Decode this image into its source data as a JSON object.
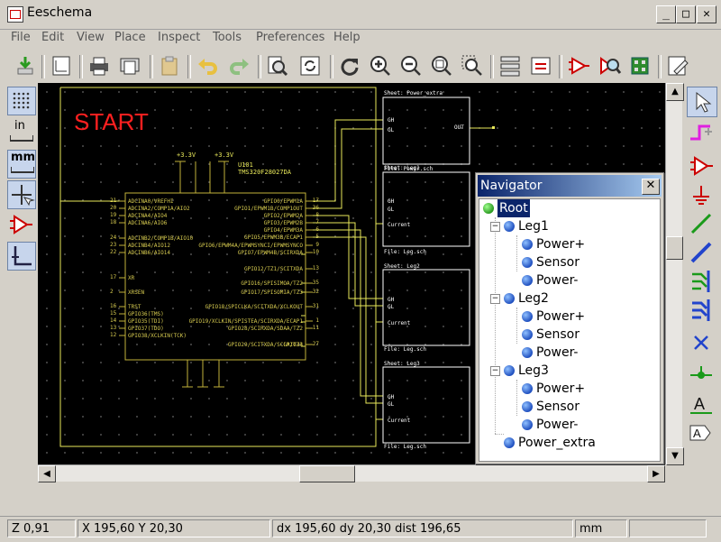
{
  "window": {
    "title": "Eeschema",
    "min": "_",
    "max": "□",
    "close": "✕"
  },
  "menu": [
    "File",
    "Edit",
    "View",
    "Place",
    "Inspect",
    "Tools",
    "Preferences",
    "Help"
  ],
  "left_toolbar": {
    "grid_icon": "grid-icon",
    "inches_label": "in",
    "mm_label": "mm",
    "cursor_icon": "crosshair-cursor-icon",
    "hidden_pins_icon": "hidden-pins-icon",
    "wire_mode_icon": "wire-angle-icon"
  },
  "schematic": {
    "start_label": "START",
    "sheets": [
      {
        "title": "Sheet: Power_extra",
        "file": "File: Power.sch",
        "pins": [
          "GH",
          "GL",
          "OUT"
        ]
      },
      {
        "title": "Sheet: Leg1",
        "file": "File: Leg.sch",
        "pins": [
          "GH",
          "GL",
          "Current"
        ]
      },
      {
        "title": "Sheet: Leg2",
        "file": "File: Leg.sch",
        "pins": [
          "GH",
          "GL",
          "Current"
        ]
      },
      {
        "title": "Sheet: Leg3",
        "file": "File: Leg.sch",
        "pins": [
          "GH",
          "GL",
          "Current"
        ]
      }
    ],
    "ic": {
      "ref": "U101",
      "value": "TMS320F28027DA",
      "power_labels": [
        "+3.3V",
        "+3.3V"
      ],
      "left_pins": [
        "ADCINA0/VREFHI",
        "ADCINA2/COMP1A/AIO2",
        "ADCINA4/AIO4",
        "ADCINA6/AIO6",
        "ADCINB2/COMP1B/AIO10",
        "ADCINB4/AIO12",
        "ADCINB6/AIO14",
        "XR",
        "XRSEN",
        "TRST",
        "GPIO36(TMS)",
        "GPIO35(TDI)",
        "GPIO37(TDO)",
        "GPIO38/XCLKIN(TCK)"
      ],
      "right_pins": [
        "GPIO0/EPWM1A",
        "GPIO1/EPWM1B/COMP1OUT",
        "GPIO2/EPWM2A",
        "GPIO3/EPWM2B",
        "GPIO4/EPWM3A",
        "GPIO5/EPWM3B/ECAP1",
        "GPIO6/EPWM4A/EPWMSYNCI/EPWMSYNCO",
        "GPIO7/EPWM4B/SCIRXDA",
        "GPIO12/TZ1/SCITXDA",
        "GPIO16/SPISIMOA/TZ2",
        "GPIO17/SPISOMIA/TZ3",
        "GPIO18/SPICLKA/SCITXDA/XCLKOUT",
        "GPIO19/XCLKIN/SPISTEA/SCIRXDA/ECAP1",
        "GPIO28/SCIRXDA/SDAA/TZ2",
        "GPIO29/SCITXDA/SCLA/TZ3",
        "GPIO34"
      ],
      "left_pin_numbers": [
        "21",
        "20",
        "19",
        "18",
        "24",
        "23",
        "22",
        "17",
        "2",
        "16",
        "15",
        "14",
        "13",
        "12"
      ],
      "right_pin_numbers": [
        "17",
        "36",
        "8",
        "7",
        "6",
        "5",
        "9",
        "10",
        "13",
        "35",
        "32",
        "31",
        "1",
        "11",
        "27"
      ]
    }
  },
  "navigator": {
    "title": "Navigator",
    "close": "✕",
    "root": "Root",
    "legs": [
      {
        "name": "Leg1",
        "children": [
          "Power+",
          "Sensor",
          "Power-"
        ]
      },
      {
        "name": "Leg2",
        "children": [
          "Power+",
          "Sensor",
          "Power-"
        ]
      },
      {
        "name": "Leg3",
        "children": [
          "Power+",
          "Sensor",
          "Power-"
        ]
      }
    ],
    "extra": "Power_extra"
  },
  "status": {
    "zoom": "Z 0,91",
    "xy": "X 195,60  Y 20,30",
    "delta": "dx 195,60  dy 20,30  dist 196,65",
    "units": "mm"
  },
  "colors": {
    "wire": "#e8e85a",
    "sheet": "#ffffff",
    "component": "#c2b23a",
    "start_text": "#ff2020",
    "navigator_title": "#0a246a"
  }
}
